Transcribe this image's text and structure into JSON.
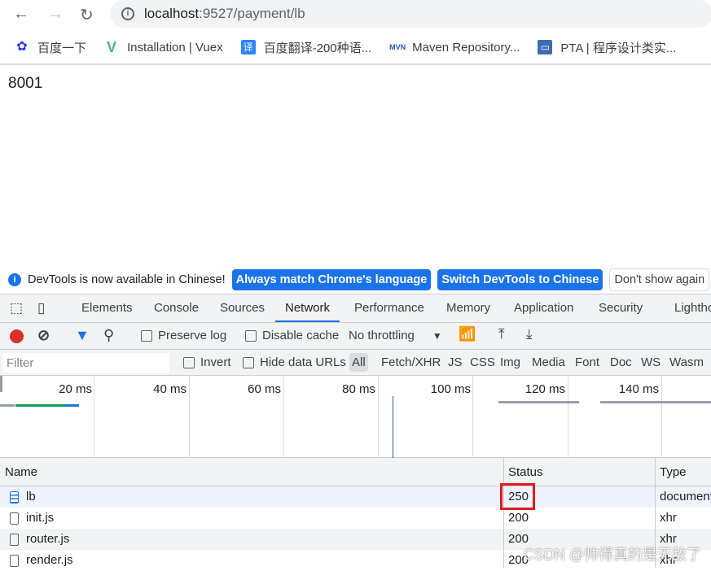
{
  "browser": {
    "url_host": "localhost",
    "url_path": ":9527/payment/lb",
    "bookmarks": [
      {
        "label": "百度一下",
        "icon": "baidu-paw-icon"
      },
      {
        "label": "Installation | Vuex",
        "icon": "vue-logo-icon"
      },
      {
        "label": "百度翻译-200种语...",
        "icon": "translate-icon"
      },
      {
        "label": "Maven Repository...",
        "icon": "maven-icon"
      },
      {
        "label": "PTA | 程序设计类实...",
        "icon": "pta-icon"
      }
    ]
  },
  "page": {
    "body_text": "8001"
  },
  "infobar": {
    "message": "DevTools is now available in Chinese!",
    "btn_match": "Always match Chrome's language",
    "btn_switch": "Switch DevTools to Chinese",
    "btn_dismiss": "Don't show again"
  },
  "devtools": {
    "tabs": [
      "Elements",
      "Console",
      "Sources",
      "Network",
      "Performance",
      "Memory",
      "Application",
      "Security",
      "Lighthouse"
    ],
    "active_tab": "Network",
    "toolbar": {
      "preserve_log": "Preserve log",
      "disable_cache": "Disable cache",
      "throttling": "No throttling"
    },
    "filter": {
      "placeholder": "Filter",
      "invert": "Invert",
      "hide_data_urls": "Hide data URLs",
      "types": [
        "All",
        "Fetch/XHR",
        "JS",
        "CSS",
        "Img",
        "Media",
        "Font",
        "Doc",
        "WS",
        "Wasm"
      ]
    },
    "timeline_ticks": [
      "20 ms",
      "40 ms",
      "60 ms",
      "80 ms",
      "100 ms",
      "120 ms",
      "140 ms"
    ],
    "columns": {
      "name": "Name",
      "status": "Status",
      "type": "Type"
    },
    "rows": [
      {
        "name": "lb",
        "status": "250",
        "type": "document"
      },
      {
        "name": "init.js",
        "status": "200",
        "type": "xhr"
      },
      {
        "name": "router.js",
        "status": "200",
        "type": "xhr"
      },
      {
        "name": "render.js",
        "status": "200",
        "type": "xhr"
      }
    ]
  },
  "watermark": "CSDN @帅得真的是无敌了",
  "colors": {
    "accent": "#1a73e8",
    "record": "#d93025",
    "highlight": "#e01b22"
  }
}
